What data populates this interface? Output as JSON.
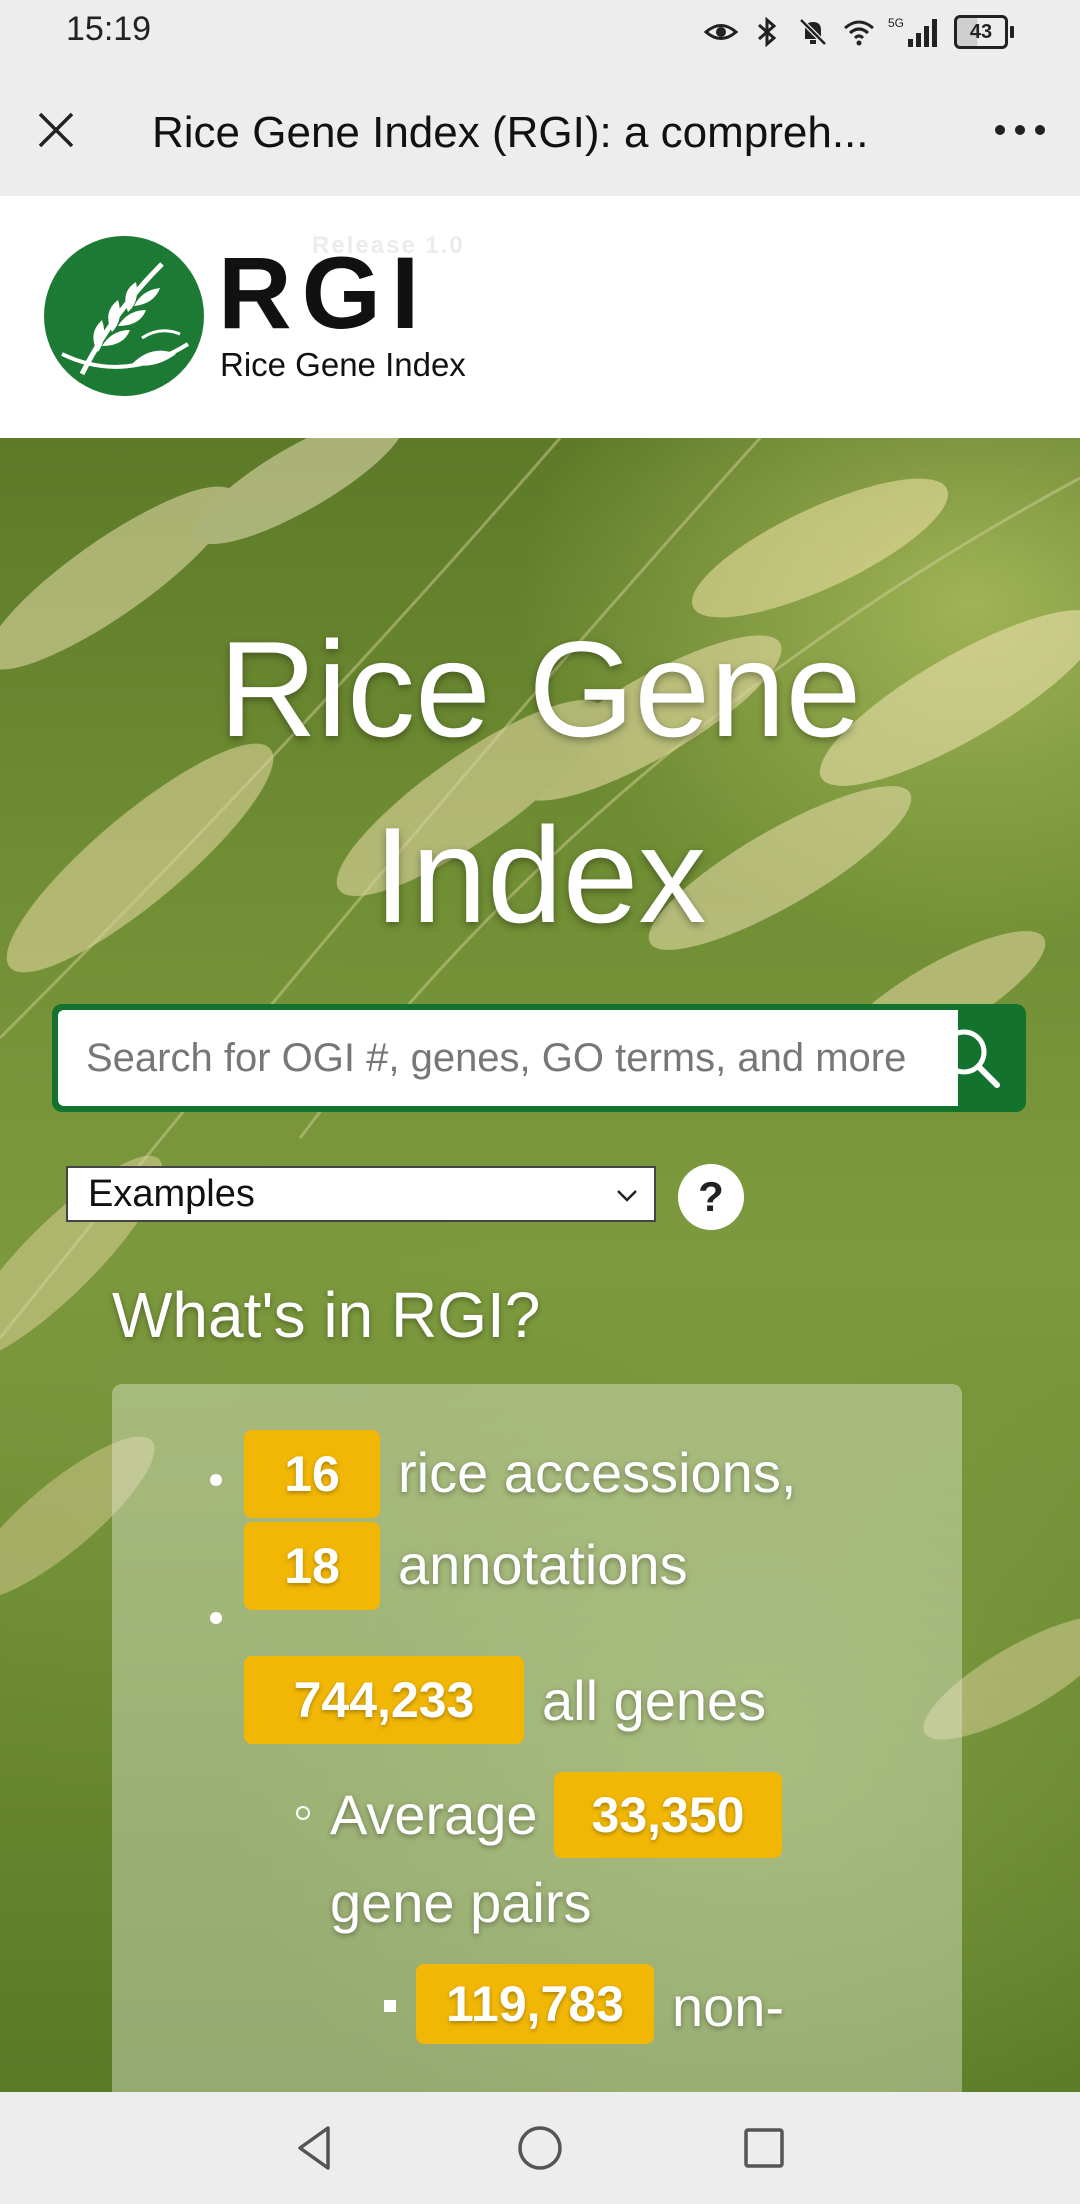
{
  "status_bar": {
    "time": "15:19",
    "network": "5G",
    "battery": "43"
  },
  "title_bar": {
    "title": "Rice Gene Index (RGI): a compreh..."
  },
  "header": {
    "release": "Release 1.0",
    "logo_text": "RGI",
    "logo_subtext": "Rice Gene Index"
  },
  "hero": {
    "title_line1": "Rice Gene",
    "title_line2": "Index"
  },
  "search": {
    "placeholder": "Search for OGI #, genes, GO terms, and more"
  },
  "examples": {
    "selected": "Examples"
  },
  "help": {
    "label": "?"
  },
  "whats_in": {
    "heading": "What's in RGI?",
    "accessions_value": "16",
    "accessions_text": "rice accessions,",
    "annotations_value": "18",
    "annotations_text": "annotations",
    "genes_value": "744,233",
    "genes_text": "all genes",
    "average_label": "Average",
    "average_value": "33,350",
    "average_text": "gene pairs",
    "non_value": "119,783",
    "non_text": "non-"
  },
  "colors": {
    "brand_green": "#14722f",
    "pill_yellow": "#f2b705",
    "chrome_gray": "#ededed"
  }
}
